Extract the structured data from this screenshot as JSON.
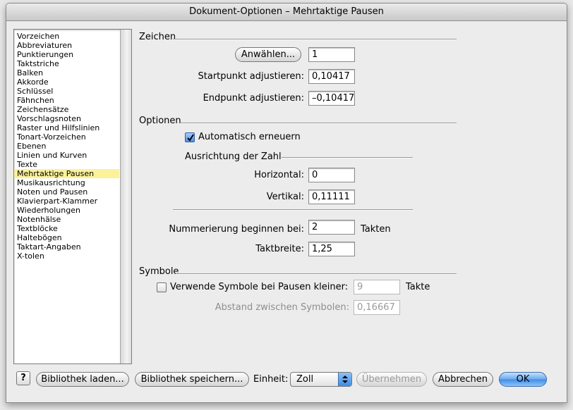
{
  "window": {
    "title": "Dokument-Optionen – Mehrtaktige Pausen"
  },
  "sidebar": {
    "items": [
      "Vorzeichen",
      "Abbreviaturen",
      "Punktierungen",
      "Taktstriche",
      "Balken",
      "Akkorde",
      "Schlüssel",
      "Fähnchen",
      "Zeichensätze",
      "Vorschlagsnoten",
      "Raster und Hilfslinien",
      "Tonart-Vorzeichen",
      "Ebenen",
      "Linien und Kurven",
      "Texte",
      "Mehrtaktige Pausen",
      "Musikausrichtung",
      "Noten und Pausen",
      "Klavierpart-Klammer",
      "Wiederholungen",
      "Notenhälse",
      "Textblöcke",
      "Haltebögen",
      "Taktart-Angaben",
      "X-tolen"
    ],
    "selected": "Mehrtaktige Pausen"
  },
  "zeichen": {
    "heading": "Zeichen",
    "select_button": "Anwählen...",
    "select_value": "1",
    "start_label": "Startpunkt adjustieren:",
    "start_value": "0,10417",
    "end_label": "Endpunkt adjustieren:",
    "end_value": "–0,10417"
  },
  "optionen": {
    "heading": "Optionen",
    "auto_update_label": "Automatisch erneuern",
    "auto_update_checked": true,
    "alignment_heading": "Ausrichtung der Zahl",
    "horizontal_label": "Horizontal:",
    "horizontal_value": "0",
    "vertical_label": "Vertikal:",
    "vertical_value": "0,11111",
    "numbering_label": "Nummerierung beginnen bei:",
    "numbering_value": "2",
    "numbering_unit": "Takten",
    "width_label": "Taktbreite:",
    "width_value": "1,25"
  },
  "symbole": {
    "heading": "Symbole",
    "use_symbols_label": "Verwende Symbole bei Pausen kleiner:",
    "use_symbols_checked": false,
    "use_symbols_value": "9",
    "use_symbols_unit": "Takte",
    "spacing_label": "Abstand zwischen Symbolen:",
    "spacing_value": "0,16667"
  },
  "footer": {
    "help": "?",
    "load_library": "Bibliothek laden...",
    "save_library": "Bibliothek speichern...",
    "unit_label": "Einheit:",
    "unit_value": "Zoll",
    "apply": "Übernehmen",
    "cancel": "Abbrechen",
    "ok": "OK"
  }
}
